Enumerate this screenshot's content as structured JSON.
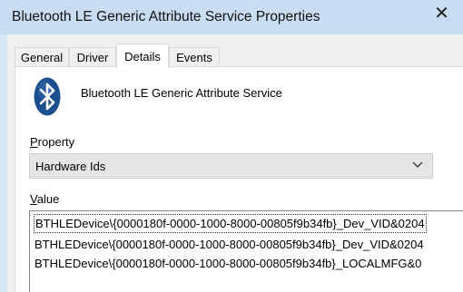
{
  "window": {
    "title": "Bluetooth LE Generic Attribute Service Properties",
    "close_glyph": "✕"
  },
  "tabs": [
    {
      "label": "General",
      "active": false
    },
    {
      "label": "Driver",
      "active": false
    },
    {
      "label": "Details",
      "active": true
    },
    {
      "label": "Events",
      "active": false
    }
  ],
  "device": {
    "icon": "bluetooth-icon",
    "name": "Bluetooth LE Generic Attribute Service"
  },
  "property": {
    "label_accel": "P",
    "label_rest": "roperty",
    "selected": "Hardware Ids"
  },
  "value": {
    "label_accel": "V",
    "label_rest": "alue",
    "items": [
      "BTHLEDevice\\{0000180f-0000-1000-8000-00805f9b34fb}_Dev_VID&0204",
      "BTHLEDevice\\{0000180f-0000-1000-8000-00805f9b34fb}_Dev_VID&0204",
      "BTHLEDevice\\{0000180f-0000-1000-8000-00805f9b34fb}_LOCALMFG&0"
    ]
  },
  "colors": {
    "titlebar": "#c9ddf2",
    "bluetooth_blue": "#1c4f8f"
  }
}
